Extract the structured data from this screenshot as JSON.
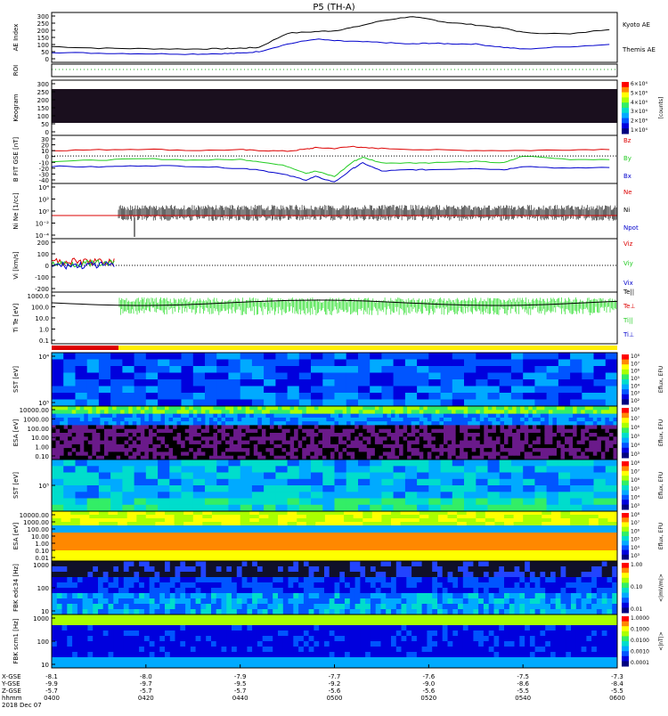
{
  "title": "P5 (TH-A)",
  "colors": {
    "kyoto_ae": "#000000",
    "themis_ae": "#0000cc",
    "bx": "#0000cc",
    "by": "#22cc22",
    "bz": "#dd0000",
    "roi_bar_red": "#dd0000",
    "roi_bar_yellow": "#ffee00"
  },
  "chart_data": [
    {
      "id": "ae",
      "type": "line",
      "ylabel": "AE Index",
      "ylim": [
        0,
        300
      ],
      "yticks": [
        "300",
        "250",
        "200",
        "150",
        "100",
        "50",
        "0"
      ],
      "series": [
        {
          "name": "Kyoto AE",
          "x": [
            0,
            5,
            10,
            15,
            18,
            20,
            22,
            25,
            28,
            30,
            32,
            35,
            38,
            40,
            42,
            45,
            48,
            50,
            55,
            60
          ],
          "values": [
            95,
            85,
            82,
            80,
            82,
            85,
            90,
            175,
            185,
            190,
            210,
            250,
            275,
            260,
            240,
            225,
            205,
            180,
            170,
            205
          ]
        },
        {
          "name": "Themis AE",
          "x": [
            0,
            5,
            10,
            15,
            18,
            20,
            22,
            25,
            28,
            30,
            32,
            35,
            38,
            40,
            42,
            45,
            48,
            50,
            55,
            60
          ],
          "values": [
            60,
            55,
            52,
            50,
            52,
            55,
            65,
            110,
            140,
            130,
            125,
            120,
            110,
            115,
            112,
            110,
            90,
            80,
            95,
            110
          ]
        }
      ]
    },
    {
      "id": "roi",
      "type": "line",
      "ylabel": "ROI",
      "yticks": []
    },
    {
      "id": "kgram",
      "type": "heatmap",
      "ylabel": "Keogram",
      "yticks": [
        "300",
        "250",
        "200",
        "150",
        "100",
        "50",
        "0"
      ],
      "colorbar": {
        "ticks": [
          "6×10⁴",
          "5×10⁴",
          "4×10⁴",
          "3×10⁴",
          "2×10⁴",
          "1×10⁴"
        ],
        "label": "[counts]"
      }
    },
    {
      "id": "bfit",
      "type": "line",
      "ylabel": "B FIT GSE [nT]",
      "ylim": [
        -40,
        30
      ],
      "yticks": [
        "30",
        "20",
        "10",
        "0",
        "-10",
        "-20",
        "-30",
        "-40"
      ],
      "series": [
        {
          "name": "Bz",
          "x": [
            0,
            5,
            10,
            15,
            20,
            22,
            25,
            27,
            28,
            30,
            32,
            33,
            35,
            40,
            45,
            50,
            55,
            60
          ],
          "values": [
            8,
            9,
            10,
            8,
            9,
            8,
            7,
            10,
            12,
            11,
            14,
            12,
            11,
            9,
            8,
            8,
            9,
            10
          ]
        },
        {
          "name": "By",
          "x": [
            0,
            5,
            10,
            15,
            20,
            22,
            25,
            27,
            28,
            30,
            32,
            33,
            35,
            38,
            40,
            45,
            48,
            50,
            55,
            60
          ],
          "values": [
            -8,
            -6,
            -4,
            -6,
            -5,
            -8,
            -15,
            -25,
            -22,
            -30,
            -8,
            -2,
            -10,
            -10,
            -10,
            -8,
            -10,
            0,
            -5,
            -5
          ]
        },
        {
          "name": "Bx",
          "x": [
            0,
            5,
            10,
            15,
            20,
            22,
            25,
            27,
            28,
            30,
            32,
            33,
            35,
            38,
            40,
            45,
            48,
            50,
            55,
            60
          ],
          "values": [
            -15,
            -16,
            -14,
            -15,
            -18,
            -20,
            -28,
            -35,
            -30,
            -38,
            -18,
            -10,
            -22,
            -20,
            -20,
            -18,
            -20,
            -15,
            -18,
            -16
          ]
        }
      ],
      "legend": [
        "Bz",
        "By",
        "Bx"
      ]
    },
    {
      "id": "ni",
      "type": "line",
      "ylabel": "Ni Ne [1/cc]",
      "yticks": [
        "10⁴",
        "10²",
        "10⁰",
        "10⁻²",
        "10⁻⁴"
      ],
      "legend": [
        "Ne",
        "Ni",
        "Npot"
      ]
    },
    {
      "id": "vi",
      "type": "line",
      "ylabel": "Vi [km/s]",
      "ylim": [
        -300,
        300
      ],
      "yticks": [
        "200",
        "100",
        "0",
        "-100",
        "-200"
      ],
      "legend": [
        "Viz",
        "Viy",
        "Vix"
      ]
    },
    {
      "id": "ti",
      "type": "line",
      "ylabel": "Ti Te [eV]",
      "yticks": [
        "1000.0",
        "100.0",
        "10.0",
        "1.0",
        "0.1"
      ],
      "legend": [
        "Te||",
        "Te⊥",
        "Ti||",
        "Ti⊥"
      ]
    },
    {
      "id": "sst1",
      "type": "heatmap",
      "ylabel": "SST [eV]",
      "yticks": [
        "10⁴",
        "10⁵"
      ],
      "colorbar": {
        "ticks": [
          "10⁸",
          "10⁷",
          "10⁶",
          "10⁵",
          "10⁴",
          "10³",
          "10²"
        ],
        "label": "Eflux, EFU"
      }
    },
    {
      "id": "esa1",
      "type": "heatmap",
      "ylabel": "ESA [eV]",
      "yticks": [
        "10000.00",
        "1000.00",
        "100.00",
        "10.00",
        "1.00",
        "0.10"
      ],
      "colorbar": {
        "ticks": [
          "10⁸",
          "10⁷",
          "10⁶",
          "10⁵",
          "10⁴",
          "10³"
        ],
        "label": "Eflux, EFU"
      }
    },
    {
      "id": "sst2",
      "type": "heatmap",
      "ylabel": "SST [eV]",
      "yticks": [
        "10⁵"
      ],
      "colorbar": {
        "ticks": [
          "10⁸",
          "10⁷",
          "10⁶",
          "10⁵",
          "10⁴",
          "10³"
        ],
        "label": "Eflux, EFU"
      }
    },
    {
      "id": "esa2",
      "type": "heatmap",
      "ylabel": "ESA [eV]",
      "yticks": [
        "10000.00",
        "1000.00",
        "100.00",
        "10.00",
        "1.00",
        "0.10",
        "0.01"
      ],
      "colorbar": {
        "ticks": [
          "10⁸",
          "10⁷",
          "10⁶",
          "10⁵",
          "10⁴",
          "10³"
        ],
        "label": "Eflux, EFU"
      }
    },
    {
      "id": "fbk1",
      "type": "heatmap",
      "ylabel": "FBK edc34 [Hz]",
      "yticks": [
        "1000",
        "100",
        "10"
      ],
      "colorbar": {
        "ticks": [
          "1.00",
          "0.10",
          "0.01"
        ],
        "label": "<|mV/m|>"
      }
    },
    {
      "id": "fbk2",
      "type": "heatmap",
      "ylabel": "FBK scm1 [Hz]",
      "yticks": [
        "1000",
        "100",
        "10"
      ],
      "colorbar": {
        "ticks": [
          "1.0000",
          "0.1000",
          "0.0100",
          "0.0010",
          "0.0001"
        ],
        "label": "<|nT|>"
      }
    }
  ],
  "xaxis": {
    "row_labels": [
      "X-GSE",
      "Y-GSE",
      "Z-GSE",
      "hhmm",
      "2018 Dec 07"
    ],
    "ticks": [
      {
        "minutes": 0,
        "x": "-8.1",
        "y": "-9.9",
        "z": "-5.7",
        "t": "0400"
      },
      {
        "minutes": 20,
        "x": "-8.0",
        "y": "-9.7",
        "z": "-5.7",
        "t": "0420"
      },
      {
        "minutes": 40,
        "x": "-7.9",
        "y": "-9.5",
        "z": "-5.7",
        "t": "0440"
      },
      {
        "minutes": 60,
        "x": "-7.7",
        "y": "-9.2",
        "z": "-5.6",
        "t": "0500"
      },
      {
        "minutes": 80,
        "x": "-7.6",
        "y": "-9.0",
        "z": "-5.6",
        "t": "0520"
      },
      {
        "minutes": 100,
        "x": "-7.5",
        "y": "-8.6",
        "z": "-5.5",
        "t": "0540"
      },
      {
        "minutes": 120,
        "x": "-7.3",
        "y": "-8.4",
        "z": "-5.5",
        "t": "0600"
      }
    ]
  }
}
